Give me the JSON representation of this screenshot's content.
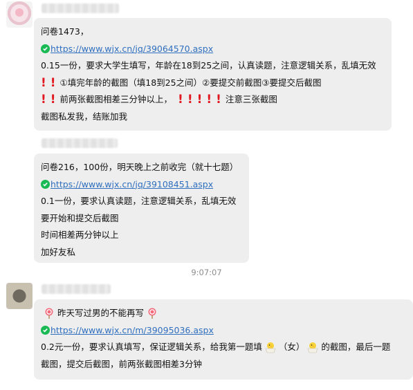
{
  "messages": [
    {
      "lines": {
        "title": "问卷1473，",
        "link": "https://www.wjx.cn/jq/39064570.aspx",
        "desc": "0.15一份，要求大学生填写，年龄在18到25之间，认真读题，注意逻辑关系，乱填无效",
        "req1": "①填完年龄的截图（填18到25之间）②要提交前截图③要提交后截图",
        "req2a": "前两张截图相差三分钟以上，",
        "req2b": "注意三张截图",
        "footer": "截图私发我，结账加我"
      }
    },
    {
      "lines": {
        "title": "问卷216，100份，明天晚上之前收完（就十七题）",
        "link": "https://www.wjx.cn/jq/39108451.aspx",
        "desc": "0.1一份，要求认真读题，注意逻辑关系，乱填无效",
        "l4": "要开始和提交后截图",
        "l5": "时间相差两分钟以上",
        "l6": "加好友私"
      }
    },
    {
      "lines": {
        "title": "昨天写过男的不能再写",
        "link": "https://www.wjx.cn/m/39095036.aspx",
        "desc_a": "0.2元一份，要求认真填写，保证逻辑关系，给我第一题填",
        "desc_b": "（女）",
        "desc_c": "的截图，最后一题",
        "desc2": "截图，提交后截图，前两张截图相差3分钟"
      }
    }
  ],
  "timestamp": "9:07:07",
  "icons": {
    "link_verified": "verified-check-icon",
    "exclamation": "red-exclamation-icon",
    "lollipop": "lollipop-icon",
    "chick": "hatching-chick-icon"
  }
}
